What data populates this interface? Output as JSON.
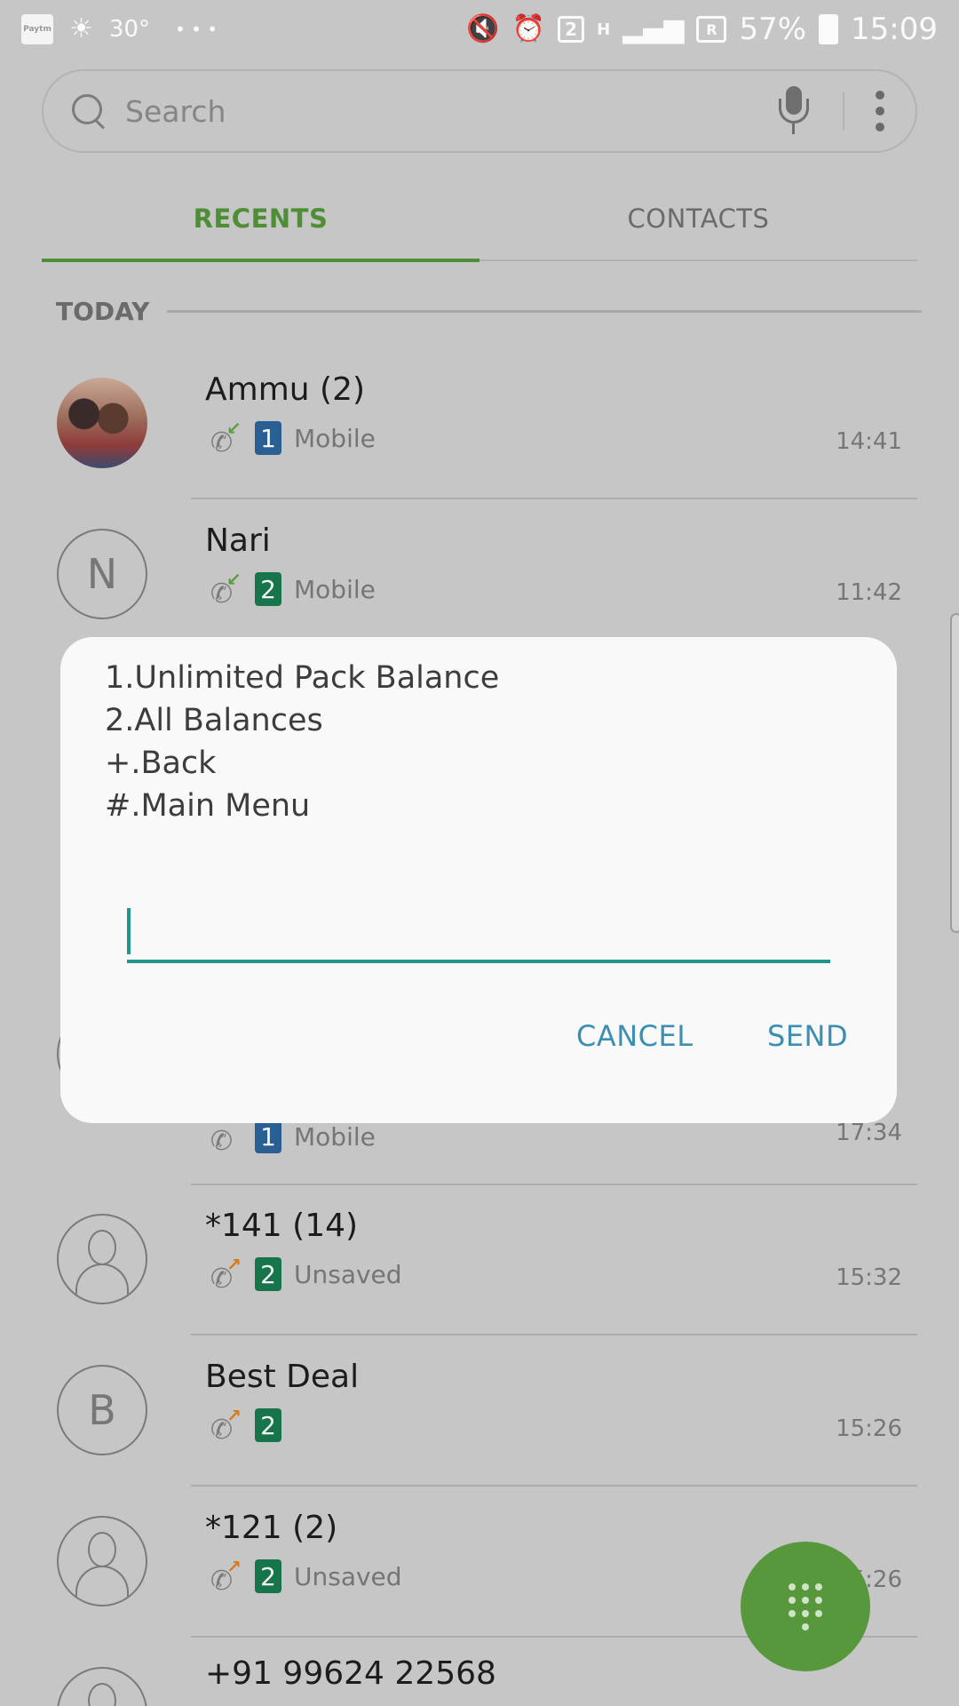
{
  "status_bar": {
    "left_app_icon": "Paytm",
    "temperature": "30°",
    "more": "• • •",
    "sim_indicator": "2",
    "network_type": "H",
    "roaming": "R",
    "battery": "57%",
    "time": "15:09"
  },
  "search": {
    "placeholder": "Search"
  },
  "tabs": [
    {
      "label": "RECENTS",
      "active": true
    },
    {
      "label": "CONTACTS",
      "active": false
    }
  ],
  "section_today": "TODAY",
  "calls": [
    {
      "name": "Ammu (2)",
      "avatar": "photo",
      "direction": "incoming",
      "sim": "1",
      "label": "Mobile",
      "time": "14:41"
    },
    {
      "name": "Nari",
      "avatar": "N",
      "direction": "incoming",
      "sim": "2",
      "label": "Mobile",
      "time": "11:42"
    },
    {
      "name": "",
      "avatar": "",
      "direction": "incoming",
      "sim": "1",
      "label": "Mobile",
      "time": "17:34"
    },
    {
      "name": "*141 (14)",
      "avatar": "person",
      "direction": "outgoing",
      "sim": "2",
      "label": "Unsaved",
      "time": "15:32"
    },
    {
      "name": "Best Deal",
      "avatar": "B",
      "direction": "outgoing",
      "sim": "2",
      "label": "",
      "time": "15:26"
    },
    {
      "name": "*121 (2)",
      "avatar": "person",
      "direction": "outgoing",
      "sim": "2",
      "label": "Unsaved",
      "time": "15:26"
    },
    {
      "name": "+91 99624 22568",
      "avatar": "person",
      "direction": "",
      "sim": "",
      "label": "",
      "time": ""
    }
  ],
  "dialog": {
    "lines": [
      "1.Unlimited Pack Balance",
      "2.All Balances",
      "+.Back",
      "#.Main Menu"
    ],
    "input_value": "",
    "cancel_label": "CANCEL",
    "send_label": "SEND"
  },
  "colors": {
    "accent_green": "#4e8f36",
    "fab_green": "#58983d",
    "dialog_teal": "#1f968b",
    "button_blue": "#3c8fb2",
    "sim1": "#2a5f93",
    "sim2": "#17744b",
    "incoming_arrow": "#5d9c3c",
    "outgoing_arrow": "#d97a1a"
  },
  "icons": {
    "search": "search-icon",
    "mic": "mic-icon",
    "more": "more-vert-icon",
    "dialpad": "dialpad-icon",
    "call": "phone-icon"
  }
}
